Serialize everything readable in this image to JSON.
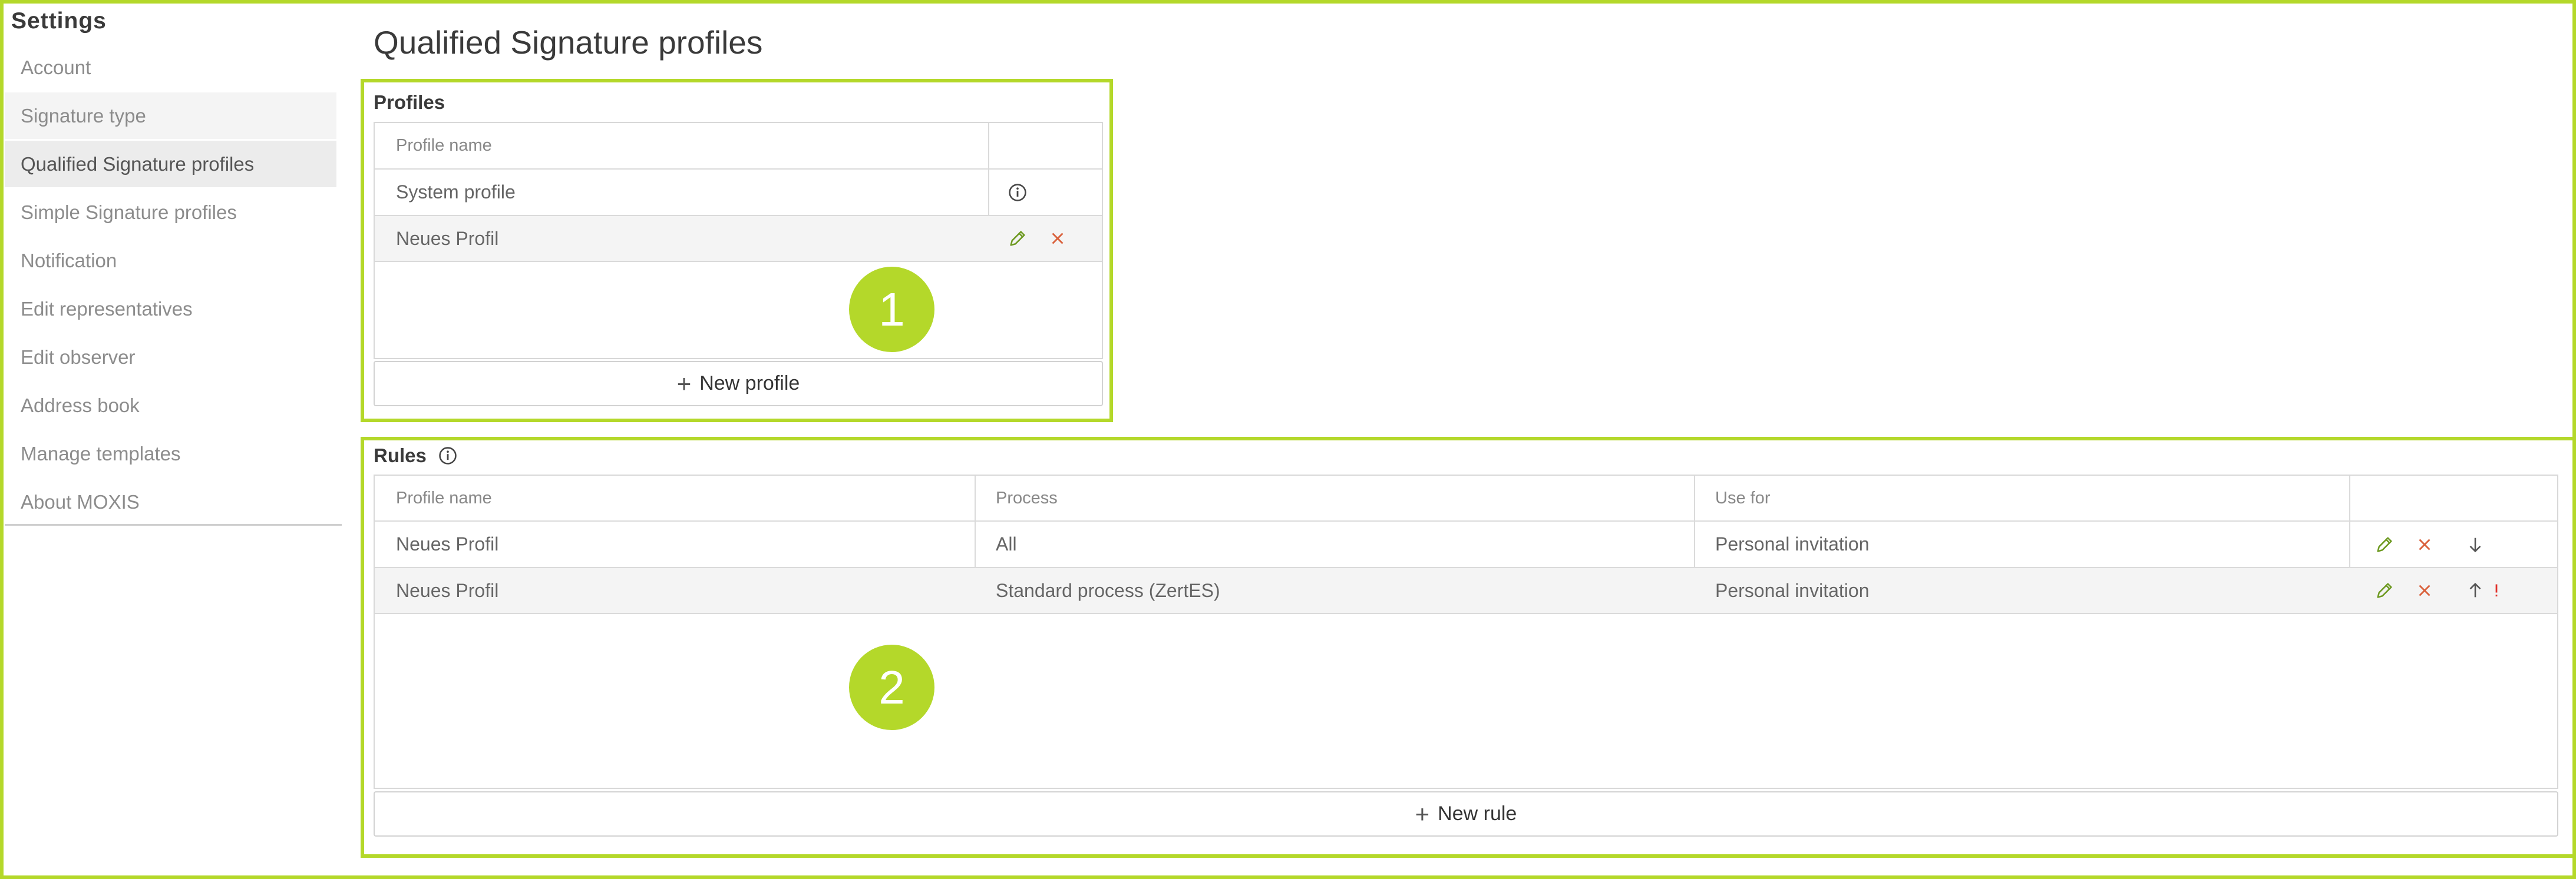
{
  "sidebar": {
    "title": "Settings",
    "items": [
      {
        "label": "Account"
      },
      {
        "label": "Signature type"
      },
      {
        "label": "Qualified Signature profiles"
      },
      {
        "label": "Simple Signature profiles"
      },
      {
        "label": "Notification"
      },
      {
        "label": "Edit representatives"
      },
      {
        "label": "Edit observer"
      },
      {
        "label": "Address book"
      },
      {
        "label": "Manage templates"
      },
      {
        "label": "About MOXIS"
      }
    ],
    "active_item": "Qualified Signature profiles"
  },
  "page": {
    "title": "Qualified Signature profiles"
  },
  "profiles": {
    "section_label": "Profiles",
    "columns": [
      "Profile name",
      ""
    ],
    "rows": [
      {
        "name": "System profile",
        "actions": [
          "info-icon"
        ]
      },
      {
        "name": "Neues Profil",
        "actions": [
          "edit-icon",
          "delete-icon"
        ]
      }
    ],
    "new_button_label": "New profile"
  },
  "rules": {
    "section_label": "Rules",
    "columns": [
      "Profile name",
      "Process",
      "Use for",
      ""
    ],
    "rows": [
      {
        "profile": "Neues Profil",
        "process": "All",
        "use_for": "Personal invitation",
        "actions": [
          "edit-icon",
          "delete-icon",
          "arrow-down-icon"
        ]
      },
      {
        "profile": "Neues Profil",
        "process": "Standard process (ZertES)",
        "use_for": "Personal invitation",
        "actions": [
          "edit-icon",
          "delete-icon",
          "arrow-up-icon",
          "warning-icon"
        ]
      }
    ],
    "new_button_label": "New rule"
  },
  "annotations": {
    "badge_1": "1",
    "badge_2": "2"
  },
  "colors": {
    "highlight_frame": "#b4d82a",
    "edit_icon": "#6e9a22",
    "delete_icon": "#d9603b",
    "warning_icon": "#e0302a"
  }
}
